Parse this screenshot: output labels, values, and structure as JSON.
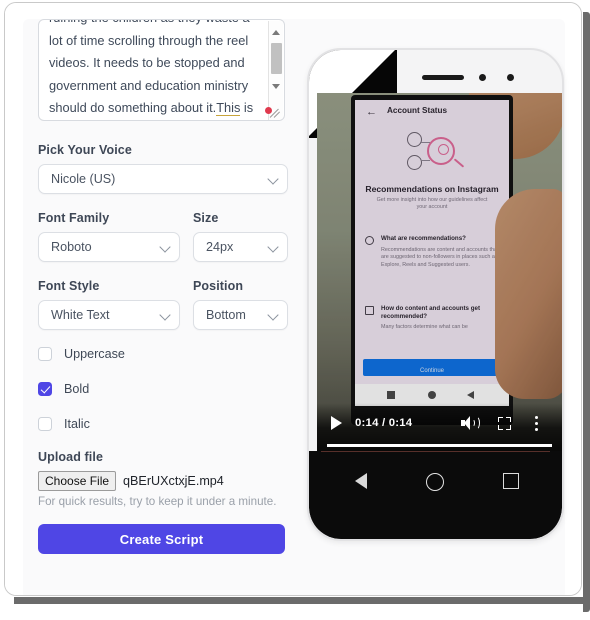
{
  "script_textarea": {
    "name": "script-text",
    "line_clipped": "ruining the children as they waste a lot",
    "visible_text": "of time scrolling through the reel videos. It needs to be stopped and government and education ministry should do something about it.",
    "misspelled_word": "This",
    "trailing_text": " is an"
  },
  "form": {
    "voice": {
      "label": "Pick Your Voice",
      "value": "Nicole (US)"
    },
    "font_family": {
      "label": "Font Family",
      "value": "Roboto"
    },
    "size": {
      "label": "Size",
      "value": "24px"
    },
    "font_style": {
      "label": "Font Style",
      "value": "White Text"
    },
    "position": {
      "label": "Position",
      "value": "Bottom"
    },
    "checkboxes": [
      {
        "label": "Uppercase",
        "checked": false
      },
      {
        "label": "Bold",
        "checked": true
      },
      {
        "label": "Italic",
        "checked": false
      }
    ],
    "upload": {
      "label": "Upload file",
      "button_label": "Choose File",
      "file_name": "qBErUXctxjE.mp4",
      "hint": "For quick results, try to keep it under a minute."
    },
    "submit_label": "Create Script"
  },
  "preview": {
    "video": {
      "current_time": "0:14",
      "duration": "0:14",
      "time_display": "0:14 / 0:14",
      "progress_percent": 100,
      "state": "ended",
      "content": {
        "header_title": "Account Status",
        "heading": "Recommendations on Instagram",
        "subheading": "Get more insight into how our guidelines affect your account",
        "faq": [
          {
            "question": "What are recommendations?",
            "answer": "Recommendations are content and accounts that are suggested to non-followers in places such as Explore, Reels and Suggested users."
          },
          {
            "question": "How do content and accounts get recommended?",
            "answer": "Many factors determine what can be"
          }
        ],
        "cta_label": "Continue"
      }
    }
  },
  "colors": {
    "accent": "#4f46e5",
    "cta_blue": "#0f72e5",
    "label": "#3e4756",
    "hint": "#9aa0a9"
  }
}
